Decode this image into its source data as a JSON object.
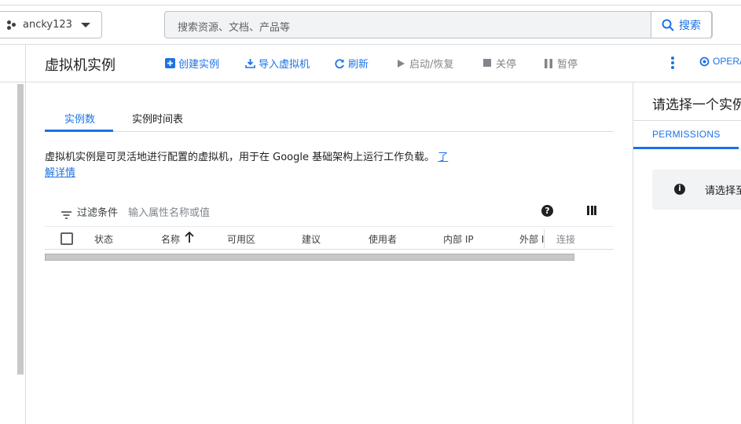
{
  "header": {
    "project_name": "ancky123",
    "search_placeholder": "搜索资源、文档、产品等",
    "search_button": "搜索"
  },
  "actionbar": {
    "title": "虚拟机实例",
    "create": "创建实例",
    "import": "导入虚拟机",
    "refresh": "刷新",
    "start": "启动/恢复",
    "stop": "关停",
    "pause": "暂停",
    "operations": "OPERA"
  },
  "main": {
    "tabs": [
      "实例数",
      "实例时间表"
    ],
    "description": "虚拟机实例是可灵活地进行配置的虚拟机，用于在 Google 基础架构上运行工作负载。",
    "learn_more_1": "了",
    "learn_more_2": "解详情",
    "filter_label": "过滤条件",
    "filter_placeholder": "输入属性名称或值",
    "help_icon": "?",
    "columns": [
      "状态",
      "名称",
      "可用区",
      "建议",
      "使用者",
      "内部 IP",
      "外部 I",
      "连接"
    ]
  },
  "right_panel": {
    "title": "请选择一个实例",
    "tab": "PERMISSIONS",
    "info_text": "请选择至少一个"
  },
  "colors": {
    "accent": "#1a73e8",
    "border": "#dadce0",
    "muted": "#80868b"
  }
}
